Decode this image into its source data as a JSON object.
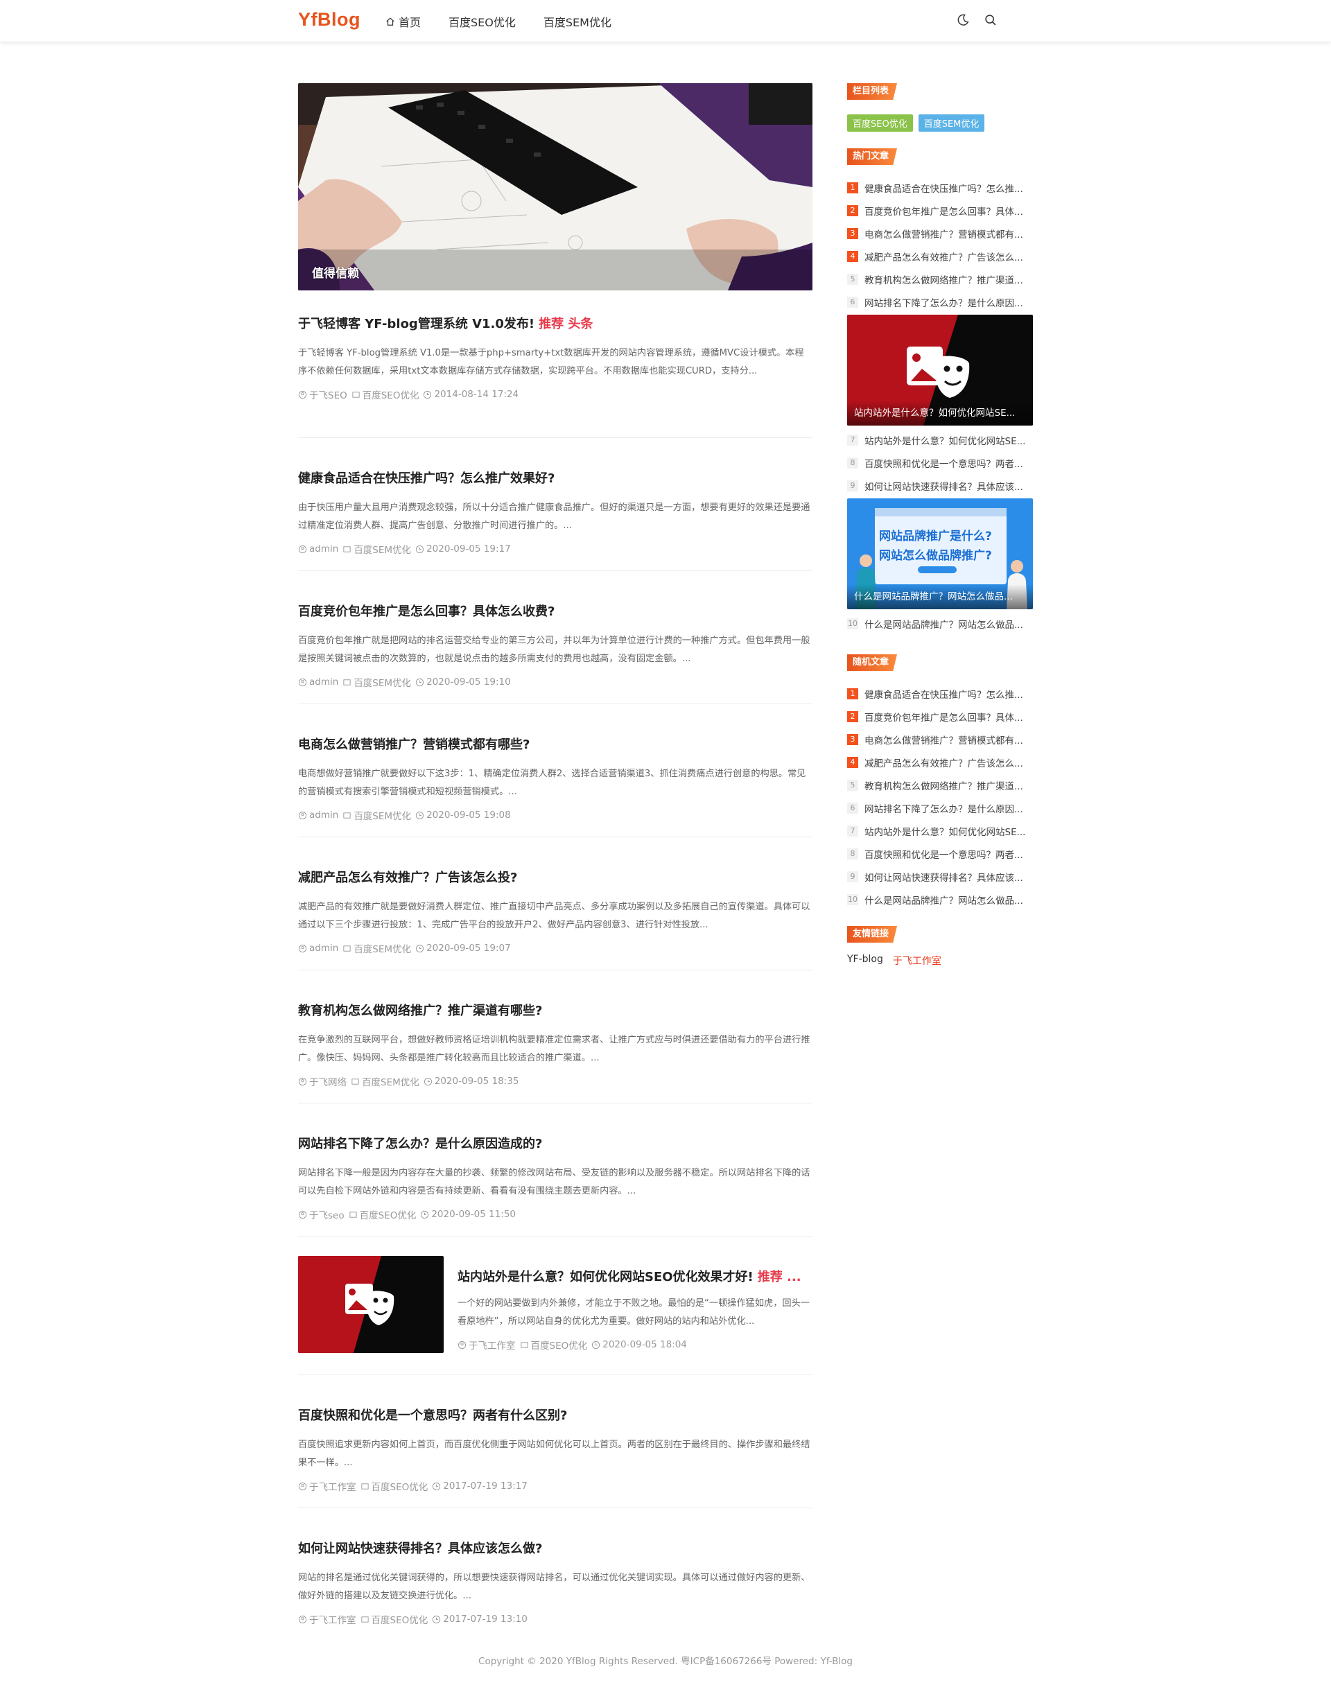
{
  "header": {
    "logo": "YfBlog",
    "nav": [
      {
        "label": "首页",
        "icon": "home-icon"
      },
      {
        "label": "百度SEO优化"
      },
      {
        "label": "百度SEM优化"
      }
    ],
    "icons": [
      "moon-icon",
      "search-icon"
    ]
  },
  "banner": {
    "caption": "值得信赖"
  },
  "posts": [
    {
      "title": "于飞轻博客 YF-blog管理系统 V1.0发布!",
      "tag": "推荐 头条",
      "excerpt": "于飞轻博客 YF-blog管理系统 V1.0是一款基于php+smarty+txt数据库开发的网站内容管理系统，遵循MVC设计模式。本程序不依赖任何数据库，采用txt文本数据库存储方式存储数据，实现跨平台。不用数据库也能实现CURD，支持分...",
      "author": "于飞SEO",
      "category": "百度SEO优化",
      "date": "2014-08-14 17:24"
    },
    {
      "title": "健康食品适合在快压推广吗？怎么推广效果好?",
      "excerpt": "由于快压用户量大且用户消费观念较强，所以十分适合推广健康食品推广。但好的渠道只是一方面，想要有更好的效果还是要通过精准定位消费人群、提高广告创意、分散推广时间进行推广的。...",
      "author": "admin",
      "category": "百度SEM优化",
      "date": "2020-09-05 19:17"
    },
    {
      "title": "百度竞价包年推广是怎么回事？具体怎么收费?",
      "excerpt": "百度竞价包年推广就是把网站的排名运营交给专业的第三方公司，并以年为计算单位进行计费的一种推广方式。但包年费用一般是按照关键词被点击的次数算的，也就是说点击的越多所需支付的费用也越高，没有固定金额。...",
      "author": "admin",
      "category": "百度SEM优化",
      "date": "2020-09-05 19:10"
    },
    {
      "title": "电商怎么做营销推广？营销模式都有哪些?",
      "excerpt": "电商想做好营销推广就要做好以下这3步：1、精确定位消费人群2、选择合适营销渠道3、抓住消费痛点进行创意的构思。常见的营销模式有搜索引擎营销模式和短视频营销模式。...",
      "author": "admin",
      "category": "百度SEM优化",
      "date": "2020-09-05 19:08"
    },
    {
      "title": "减肥产品怎么有效推广？广告该怎么投?",
      "excerpt": "减肥产品的有效推广就是要做好消费人群定位、推广直接切中产品亮点、多分享成功案例以及多拓展自己的宣传渠道。具体可以通过以下三个步骤进行投放：1、完成广告平台的投放开户2、做好产品内容创意3、进行针对性投放...",
      "author": "admin",
      "category": "百度SEM优化",
      "date": "2020-09-05 19:07"
    },
    {
      "title": "教育机构怎么做网络推广？推广渠道有哪些?",
      "excerpt": "在竞争激烈的互联网平台，想做好教师资格证培训机构就要精准定位需求者、让推广方式应与时俱进还要借助有力的平台进行推广。像快压、妈妈网、头条都是推广转化较高而且比较适合的推广渠道。...",
      "author": "于飞网络",
      "category": "百度SEM优化",
      "date": "2020-09-05 18:35"
    },
    {
      "title": "网站排名下降了怎么办？是什么原因造成的?",
      "excerpt": "网站排名下降一般是因为内容存在大量的抄袭、频繁的修改网站布局、受友链的影响以及服务器不稳定。所以网站排名下降的话可以先自检下网站外链和内容是否有持续更新、看看有没有围绕主题去更新内容。...",
      "author": "于飞seo",
      "category": "百度SEO优化",
      "date": "2020-09-05 11:50"
    },
    {
      "title": "站内站外是什么意？如何优化网站SEO优化效果才好!",
      "tag": "推荐 ...",
      "excerpt": "一个好的网站要做到内外兼修，才能立于不败之地。最怕的是“一顿操作猛如虎，回头一看原地杵”，所以网站自身的优化尤为重要。做好网站的站内和站外优化...",
      "author": "于飞工作室",
      "category": "百度SEO优化",
      "date": "2020-09-05 18:04"
    },
    {
      "title": "百度快照和优化是一个意思吗？两者有什么区别?",
      "excerpt": "百度快照追求更新内容如何上首页，而百度优化侧重于网站如何优化可以上首页。两者的区别在于最终目的、操作步骤和最终结果不一样。...",
      "author": "于飞工作室",
      "category": "百度SEO优化",
      "date": "2017-07-19 13:17"
    },
    {
      "title": "如何让网站快速获得排名？具体应该怎么做?",
      "excerpt": "网站的排名是通过优化关键词获得的，所以想要快速获得网站排名，可以通过优化关键词实现。具体可以通过做好内容的更新、做好外链的搭建以及友链交换进行优化。...",
      "author": "于飞工作室",
      "category": "百度SEO优化",
      "date": "2017-07-19 13:10"
    }
  ],
  "sidebar": {
    "cat_title": "栏目列表",
    "categories": [
      {
        "label": "百度SEO优化",
        "color": "#8bc34a"
      },
      {
        "label": "百度SEM优化",
        "color": "#5bb2e6"
      }
    ],
    "hot_title": "热门文章",
    "hot_a": [
      {
        "n": "1",
        "text": "健康食品适合在快压推广吗？怎么推..."
      },
      {
        "n": "2",
        "text": "百度竞价包年推广是怎么回事？具体..."
      },
      {
        "n": "3",
        "text": "电商怎么做营销推广？营销模式都有..."
      },
      {
        "n": "4",
        "text": "减肥产品怎么有效推广？广告该怎么..."
      },
      {
        "n": "5",
        "text": "教育机构怎么做网络推广？推广渠道..."
      },
      {
        "n": "6",
        "text": "网站排名下降了怎么办？是什么原因..."
      }
    ],
    "card1_caption": "站内站外是什么意？如何优化网站SE...",
    "hot_b": [
      {
        "n": "7",
        "text": "站内站外是什么意？如何优化网站SE..."
      },
      {
        "n": "8",
        "text": "百度快照和优化是一个意思吗？两者..."
      },
      {
        "n": "9",
        "text": "如何让网站快速获得排名？具体应该..."
      }
    ],
    "card2_caption": "什么是网站品牌推广？网站怎么做品...",
    "card2_heading1": "网站品牌推广是什么?",
    "card2_heading2": "网站怎么做品牌推广?",
    "hot_c": [
      {
        "n": "10",
        "text": "什么是网站品牌推广？网站怎么做品..."
      }
    ],
    "rand_title": "随机文章",
    "rand": [
      {
        "n": "1",
        "text": "健康食品适合在快压推广吗？怎么推..."
      },
      {
        "n": "2",
        "text": "百度竞价包年推广是怎么回事？具体..."
      },
      {
        "n": "3",
        "text": "电商怎么做营销推广？营销模式都有..."
      },
      {
        "n": "4",
        "text": "减肥产品怎么有效推广？广告该怎么..."
      },
      {
        "n": "5",
        "text": "教育机构怎么做网络推广？推广渠道..."
      },
      {
        "n": "6",
        "text": "网站排名下降了怎么办？是什么原因..."
      },
      {
        "n": "7",
        "text": "站内站外是什么意？如何优化网站SE..."
      },
      {
        "n": "8",
        "text": "百度快照和优化是一个意思吗？两者..."
      },
      {
        "n": "9",
        "text": "如何让网站快速获得排名？具体应该..."
      },
      {
        "n": "10",
        "text": "什么是网站品牌推广？网站怎么做品..."
      }
    ],
    "links_title": "友情链接",
    "links": [
      {
        "label": "YF-blog",
        "color": "#333333"
      },
      {
        "label": "于飞工作室",
        "color": "#e83b1d"
      }
    ]
  },
  "footer": {
    "text": "Copyright © 2020 YfBlog Rights Reserved. 粤ICP备16067266号 Powered: Yf-Blog"
  }
}
